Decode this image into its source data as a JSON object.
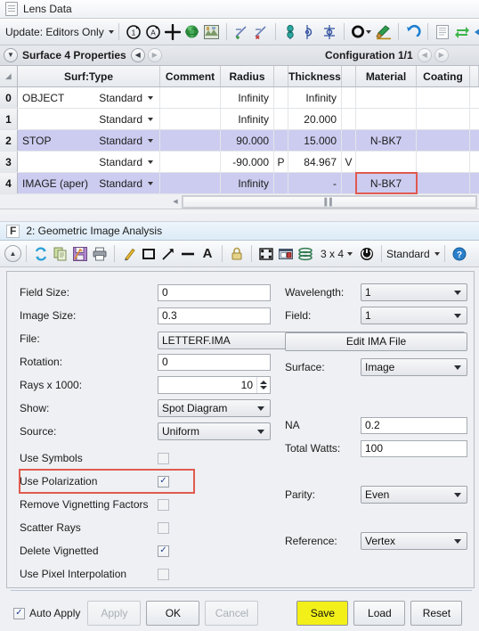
{
  "lens_window": {
    "title": "Lens Data",
    "title_icon": "document-icon",
    "toolbar": {
      "update_label": "Update: Editors Only",
      "icons": [
        {
          "name": "single-step-icon",
          "glyph": "C1"
        },
        {
          "name": "all-step-icon",
          "glyph": "CA"
        },
        {
          "name": "move-icon",
          "glyph": "+"
        },
        {
          "name": "globe-icon",
          "glyph": "globe"
        },
        {
          "name": "layout-image-icon",
          "glyph": "image"
        },
        {
          "name": "insert-surface-before-icon",
          "glyph": "axis-plus"
        },
        {
          "name": "delete-surface-icon",
          "glyph": "axis-x"
        },
        {
          "name": "tilt-decenter-icon",
          "glyph": "tilt"
        },
        {
          "name": "fold-mirror-icon",
          "glyph": "fold"
        },
        {
          "name": "coordinate-return-icon",
          "glyph": "coord"
        },
        {
          "name": "aperture-icon",
          "glyph": "ring"
        },
        {
          "name": "surface-color-icon",
          "glyph": "brush"
        },
        {
          "name": "undo-icon",
          "glyph": "undo"
        },
        {
          "name": "notes-icon",
          "glyph": "notes"
        },
        {
          "name": "swap-icon",
          "glyph": "swap"
        },
        {
          "name": "collapse-icon",
          "glyph": "collapse"
        },
        {
          "name": "expand-icon",
          "glyph": "expand"
        }
      ]
    },
    "properties_bar": {
      "expander_icon": "chevron-down-icon",
      "title": "Surface 4 Properties",
      "prev_icon": "chevron-left-icon",
      "next_icon": "chevron-right-icon",
      "configuration": "Configuration 1/1",
      "config_prev_icon": "chevron-left-icon",
      "config_next_icon": "chevron-right-icon"
    },
    "table": {
      "columns": [
        "",
        "Surf:Type",
        "Comment",
        "Radius",
        "",
        "Thickness",
        "",
        "Material",
        "Coating",
        ""
      ],
      "rows": [
        {
          "index": "0",
          "name": "OBJECT",
          "type": "Standard",
          "comment": "",
          "radius": "Infinity",
          "radius_flag": "",
          "thickness": "Infinity",
          "thickness_flag": "",
          "material": "",
          "coating": "",
          "highlighted": false,
          "material_outlined": false
        },
        {
          "index": "1",
          "name": "",
          "type": "Standard",
          "comment": "",
          "radius": "Infinity",
          "radius_flag": "",
          "thickness": "20.000",
          "thickness_flag": "",
          "material": "",
          "coating": "",
          "highlighted": false,
          "material_outlined": false
        },
        {
          "index": "2",
          "name": "STOP",
          "type": "Standard",
          "comment": "",
          "radius": "90.000",
          "radius_flag": "",
          "thickness": "15.000",
          "thickness_flag": "",
          "material": "N-BK7",
          "coating": "",
          "highlighted": true,
          "material_outlined": false
        },
        {
          "index": "3",
          "name": "",
          "type": "Standard",
          "comment": "",
          "radius": "-90.000",
          "radius_flag": "P",
          "thickness": "84.967",
          "thickness_flag": "V",
          "material": "",
          "coating": "",
          "highlighted": false,
          "material_outlined": false
        },
        {
          "index": "4",
          "name": "IMAGE (aper)",
          "type": "Standard",
          "comment": "",
          "radius": "Infinity",
          "radius_flag": "",
          "thickness": "-",
          "thickness_flag": "",
          "material": "N-BK7",
          "coating": "",
          "highlighted": true,
          "material_outlined": true
        }
      ]
    }
  },
  "analysis_window": {
    "badge": "F",
    "title": "2: Geometric Image Analysis",
    "toolbar": {
      "icons": [
        {
          "name": "collapse-settings-icon",
          "glyph": "chevron-up"
        },
        {
          "name": "refresh-icon",
          "glyph": "refresh"
        },
        {
          "name": "copy-icon",
          "glyph": "copy"
        },
        {
          "name": "save-icon",
          "glyph": "save"
        },
        {
          "name": "print-icon",
          "glyph": "print"
        },
        {
          "name": "annotate-pencil-icon",
          "glyph": "pencil"
        },
        {
          "name": "draw-rectangle-icon",
          "glyph": "rect"
        },
        {
          "name": "draw-arrow-icon",
          "glyph": "arrow"
        },
        {
          "name": "draw-line-icon",
          "glyph": "line"
        },
        {
          "name": "add-text-icon",
          "glyph": "A"
        },
        {
          "name": "lock-icon",
          "glyph": "lock"
        },
        {
          "name": "fit-window-icon",
          "glyph": "fit"
        },
        {
          "name": "detach-window-icon",
          "glyph": "detach"
        },
        {
          "name": "layers-icon",
          "glyph": "layers"
        }
      ],
      "grid_label": "3 x 4",
      "grid_dropdown_icon": "chevron-down-icon",
      "refresh-all-icon": "power-refresh-icon",
      "style_label": "Standard",
      "style_dropdown_icon": "chevron-down-icon",
      "help_icon": "help-icon"
    },
    "settings": {
      "left": [
        {
          "label": "Field Size:",
          "control": "input",
          "value": "0",
          "name": "field-size"
        },
        {
          "label": "Image Size:",
          "control": "input",
          "value": "0.3",
          "name": "image-size"
        },
        {
          "label": "File:",
          "control": "combo",
          "value": "LETTERF.IMA",
          "name": "file"
        },
        {
          "label": "Rotation:",
          "control": "input",
          "value": "0",
          "name": "rotation"
        },
        {
          "label": "Rays x 1000:",
          "control": "spinner",
          "value": "10",
          "name": "rays-x-1000"
        },
        {
          "label": "Show:",
          "control": "combo",
          "value": "Spot Diagram",
          "name": "show"
        },
        {
          "label": "Source:",
          "control": "combo",
          "value": "Uniform",
          "name": "source"
        }
      ],
      "checkboxes": [
        {
          "label": "Use Symbols",
          "checked": false,
          "outlined": false,
          "name": "use-symbols"
        },
        {
          "label": "Use Polarization",
          "checked": true,
          "outlined": true,
          "name": "use-polarization"
        },
        {
          "label": "Remove Vignetting Factors",
          "checked": false,
          "outlined": false,
          "name": "remove-vignetting-factors"
        },
        {
          "label": "Scatter Rays",
          "checked": false,
          "outlined": false,
          "name": "scatter-rays"
        },
        {
          "label": "Delete Vignetted",
          "checked": true,
          "outlined": false,
          "name": "delete-vignetted"
        },
        {
          "label": "Use Pixel Interpolation",
          "checked": false,
          "outlined": false,
          "name": "use-pixel-interpolation"
        }
      ],
      "right": [
        {
          "label": "Wavelength:",
          "control": "combo",
          "value": "1",
          "name": "wavelength"
        },
        {
          "label": "Field:",
          "control": "combo",
          "value": "1",
          "name": "field"
        },
        {
          "label": "",
          "control": "button",
          "value": "Edit IMA File",
          "name": "edit-ima-file"
        },
        {
          "label": "Surface:",
          "control": "combo",
          "value": "Image",
          "name": "surface"
        },
        {
          "label": "NA",
          "control": "input",
          "value": "0.2",
          "name": "na"
        },
        {
          "label": "Total Watts:",
          "control": "input",
          "value": "100",
          "name": "total-watts"
        },
        {
          "label": "Parity:",
          "control": "combo",
          "value": "Even",
          "name": "parity"
        },
        {
          "label": "Reference:",
          "control": "combo",
          "value": "Vertex",
          "name": "reference"
        }
      ]
    },
    "footer": {
      "auto_apply_label": "Auto Apply",
      "auto_apply_checked": true,
      "apply_label": "Apply",
      "apply_enabled": false,
      "ok_label": "OK",
      "cancel_label": "Cancel",
      "cancel_enabled": false,
      "save_label": "Save",
      "load_label": "Load",
      "reset_label": "Reset"
    }
  },
  "colors": {
    "highlight_row": "#ccccf0",
    "outline_red": "#e05a4f",
    "save_yellow": "#f2f018"
  }
}
